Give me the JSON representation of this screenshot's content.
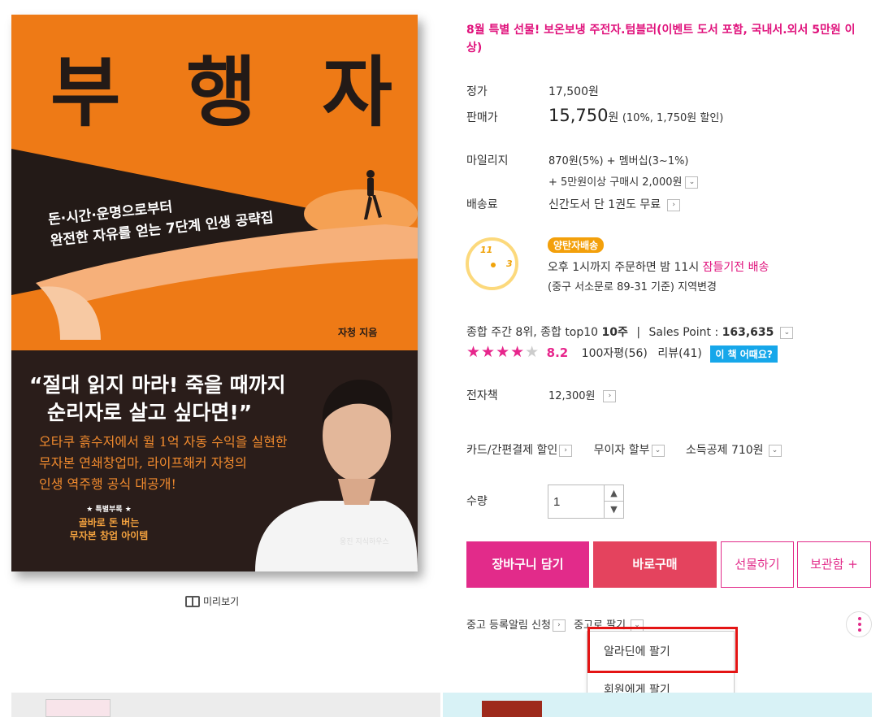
{
  "cover": {
    "title": "부 행 자",
    "subtitle_line1": "돈·시간·운명으로부터",
    "subtitle_line2": "완전한 자유를 얻는 7단계 인생 공략집",
    "author": "자청 지음",
    "quote_line1": "“절대 읽지 마라! 죽을 때까지",
    "quote_line2": "순리자로 살고 싶다면!”",
    "desc_line1": "오타쿠 흙수저에서 월 1억 자동 수익을 실현한",
    "desc_line2": "무자본 연쇄창업마, 라이프해커 자청의",
    "desc_line3": "인생 역주행 공식 대공개!",
    "badge_small": "★ 특별부록 ★",
    "badge_line1": "골바로 돈 버는",
    "badge_line2": "무자본 창업 아이템",
    "publisher": "웅진 지식하우스"
  },
  "preview_label": "미리보기",
  "promo": "8월 특별 선물! 보온보냉 주전자.텀블러(이벤트 도서 포함, 국내서.외서 5만원 이상)",
  "price": {
    "list_label": "정가",
    "list_value": "17,500원",
    "sale_label": "판매가",
    "sale_value": "15,750",
    "sale_unit": "원",
    "sale_note": "(10%, 1,750원 할인)"
  },
  "mileage": {
    "label": "마일리지",
    "line1": "870원(5%) + 멤버십(3~1%)",
    "line2": "+ 5만원이상 구매시 2,000원"
  },
  "shipping": {
    "label": "배송료",
    "value": "신간도서 단 1권도 무료"
  },
  "delivery": {
    "clock_11": "11",
    "clock_3": "3",
    "badge": "양탄자배송",
    "line1_prefix": "오후 1시까지 주문하면 밤 11시 ",
    "line1_pink": "잠들기전 배송",
    "line2": "(중구 서소문로 89-31 기준) 지역변경"
  },
  "ranking": {
    "text_prefix": "종합 주간 8위, 종합 top10 ",
    "weeks": "10주",
    "separator": "|",
    "sales_label": "Sales Point : ",
    "sales_value": "163,635"
  },
  "review": {
    "stars_filled": "★★★★",
    "stars_empty": "★",
    "rating": "8.2",
    "count100": "100자평(56)",
    "count_review": "리뷰(41)",
    "button": "이 책 어때요?"
  },
  "ebook": {
    "label": "전자책",
    "value": "12,300원"
  },
  "payment": {
    "card": "카드/간편결제 할인",
    "installment": "무이자 할부",
    "tax": "소득공제 710원"
  },
  "quantity": {
    "label": "수량",
    "value": "1"
  },
  "buttons": {
    "cart": "장바구니 담기",
    "buy": "바로구매",
    "gift": "선물하기",
    "keep": "보관함 +"
  },
  "used": {
    "alert": "중고 등록알림 신청",
    "sell": "중고로 팔기"
  },
  "dropdown": {
    "item1": "알라딘에 팔기",
    "item2": "회원에게 팔기"
  },
  "colors": {
    "accent_pink": "#e22b8a",
    "buy_red": "#e4435e",
    "highlight_red": "#e41414",
    "cover_orange": "#ee7a16"
  }
}
